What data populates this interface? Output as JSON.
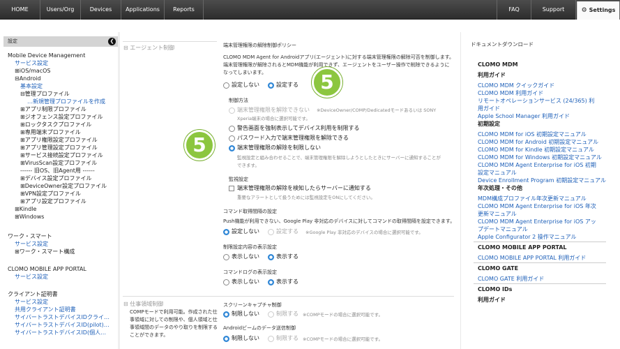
{
  "nav": {
    "home": "HOME",
    "users": "Users/Org",
    "devices": "Devices",
    "apps": "Applications",
    "reports": "Reports",
    "faq": "FAQ",
    "support": "Support",
    "settings": "Settings"
  },
  "sidebar": {
    "header": "設定",
    "lines": [
      "Mobile Device Management",
      "サービス設定",
      "⊞iOS/macOS",
      "⊟Android",
      "基本設定",
      "⊟管理プロファイル",
      "…新規管理プロファイルを作成",
      "⊞アプリ制限プロファイル",
      "⊞ジオフェンス設定プロファイル",
      "⊞ロックタスクプロファイル",
      "⊞専用端末プロファイル",
      "⊞アプリ権限設定プロファイル",
      "⊞アプリ管理設定プロファイル",
      "⊞サービス接続設定プロファイル",
      "⊞VirusScan設定プロファイル",
      "------ 旧OS、旧Agent用 ------",
      "⊞デバイス設定プロファイル",
      "⊞DeviceOwner設定プロファイル",
      "⊞VPN設定プロファイル",
      "⊞アプリ設定プロファイル",
      "⊞Kindle",
      "⊞Windows",
      "ワーク・スマート",
      "サービス設定",
      "⊞ワーク・スマート構成",
      "CLOMO MOBILE APP PORTAL",
      "サービス設定",
      "クライアント証明書",
      "サービス設定",
      "共用クライアント証明書",
      "サイバートラストデバイスIDクライ…",
      "サイバートラストデバイスID(pilot)…",
      "サイバートラストデバイスID(個人…"
    ]
  },
  "content": {
    "section1": "⊟ エージェント制御",
    "policy_title": "端末管理権限の解除制御ポリシー",
    "policy_desc1": "CLOMO MDM Agent for Androidアプリ(エージェント)に対する端末管理権限の解除可否を制御します。",
    "policy_desc2": "端末管理権限が解除されるとMDM機能が利用できず、エージェントをユーザー操作で削除できるように",
    "policy_desc3": "なってしまいます。",
    "opt_no": "設定しない",
    "opt_yes": "設定する",
    "method_title": "制御方法",
    "m1": "端末管理権限を解除できない",
    "m1_note": "※DeviceOwner/COMP/Dedicatedモードあるいは SONY",
    "m1_note2": "Xperia端末の場合に選択可能です。",
    "m2": "警告画面を強制表示してデバイス利用を制限する",
    "m3": "パスワード入力で端末管理権限を解除できる",
    "m4": "端末管理権限の解除を制限しない",
    "m4_desc1": "監視設定と組み合わせることで、端末管理権限を解除しようとしたときにサーバーに通知することが",
    "m4_desc2": "できます。",
    "monitor_title": "監視設定",
    "monitor_opt": "端末管理権限の解除を検知したらサーバーに通知する",
    "monitor_note": "重要なアラートとして扱うためには監視設定をONにしてください。",
    "cmd_title": "コマンド取得間隔の設定",
    "cmd_desc": "Push機能が利用できない、Google Play 非対応のデバイスに対してコマンドの取得間隔を設定できます。",
    "cmd_no": "設定しない",
    "cmd_yes": "設定する",
    "cmd_note": "※Google Play 非対応のデバイスの場合に選択可能です。",
    "restrict_title": "制限設定内容の表示設定",
    "r_no": "表示しない",
    "r_yes": "表示する",
    "log_title": "コマンドログの表示設定",
    "l_no": "表示しない",
    "l_yes": "表示する",
    "section2": "⊟ 仕事領域制御",
    "s2_desc1": "COMPモードで利用可能。作成された仕",
    "s2_desc2": "事領域に対しての制限や、個人領域と仕",
    "s2_desc3": "事領域間のデータのやり取りを制限する",
    "s2_desc4": "ことができます。",
    "cap_title": "スクリーンキャプチャ制御",
    "cap_limit": "制限しない",
    "cap_do": "制限する",
    "cap_note": "※COMPモードの場合に選択可能です。",
    "beam_title": "Androidビームのデータ送信制御",
    "beam_limit": "制限しない",
    "beam_do": "制限する",
    "beam_note": "※COMPモードの場合に選択可能です。",
    "badge1": "5",
    "badge2": "5"
  },
  "right": {
    "title": "ドキュメントダウンロード",
    "lines": [
      [
        "b",
        "CLOMO MDM"
      ],
      [
        "b",
        "利用ガイド"
      ],
      [
        "l",
        "CLOMO MDM クイックガイド"
      ],
      [
        "l",
        "CLOMO MDM 利用ガイド"
      ],
      [
        "l",
        "リモートオペレーションサービス (24/365) 利"
      ],
      [
        "l",
        "用ガイド"
      ],
      [
        "l",
        "Apple School Manager 利用ガイド"
      ],
      [
        "b",
        "初期設定"
      ],
      [
        "l",
        "CLOMO MDM for iOS 初期設定マニュアル"
      ],
      [
        "l",
        "CLOMO MDM for Android 初期設定マニュアル"
      ],
      [
        "l",
        "CLOMO MDM for Kindle 初期設定マニュアル"
      ],
      [
        "l",
        "CLOMO MDM for Windows 初期設定マニュアル"
      ],
      [
        "l",
        "CLOMO MDM Agent Enterprise for iOS 初期"
      ],
      [
        "l",
        "設定マニュアル"
      ],
      [
        "l",
        "Device Enrollment Program 初期設定マニュアル"
      ],
      [
        "b",
        "年次処理・その他"
      ],
      [
        "l",
        "MDM構成プロファイル年次更新マニュアル"
      ],
      [
        "l",
        "CLOMO MDM Agent Enterprise for iOS 年次"
      ],
      [
        "l",
        "更新マニュアル"
      ],
      [
        "l",
        "CLOMO MDM Agent Enterprise for iOS アッ"
      ],
      [
        "l",
        "プデートマニュアル"
      ],
      [
        "l",
        "Apple Configurator 2 操作マニュアル"
      ],
      [
        "b",
        "CLOMO MOBILE APP PORTAL"
      ],
      [
        "l",
        "CLOMO MOBILE APP PORTAL 利用ガイド"
      ],
      [
        "b",
        "CLOMO GATE"
      ],
      [
        "l",
        "CLOMO GATE 利用ガイド"
      ],
      [
        "b",
        "CLOMO IDs"
      ],
      [
        "b",
        "利用ガイド"
      ]
    ]
  },
  "colors": {
    "accent": "#2e86d6",
    "badge": "#8cc63f",
    "link": "#1d5fb8"
  }
}
